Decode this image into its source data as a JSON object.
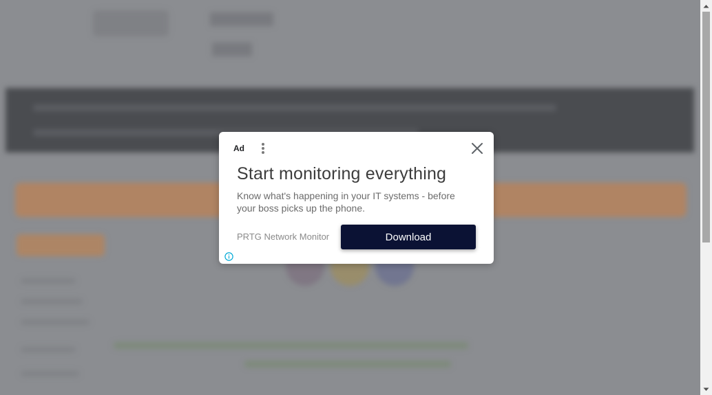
{
  "ad": {
    "label": "Ad",
    "headline": "Start monitoring everything",
    "body": "Know what's happening in your IT systems - before your boss picks up the phone.",
    "advertiser": "PRTG Network Monitor",
    "cta": "Download",
    "cta_color": "#0b1234",
    "icons": {
      "menu": "vertical-dots-icon",
      "close": "close-icon",
      "info": "info-icon"
    }
  },
  "overlay_color": "#8b8d91"
}
